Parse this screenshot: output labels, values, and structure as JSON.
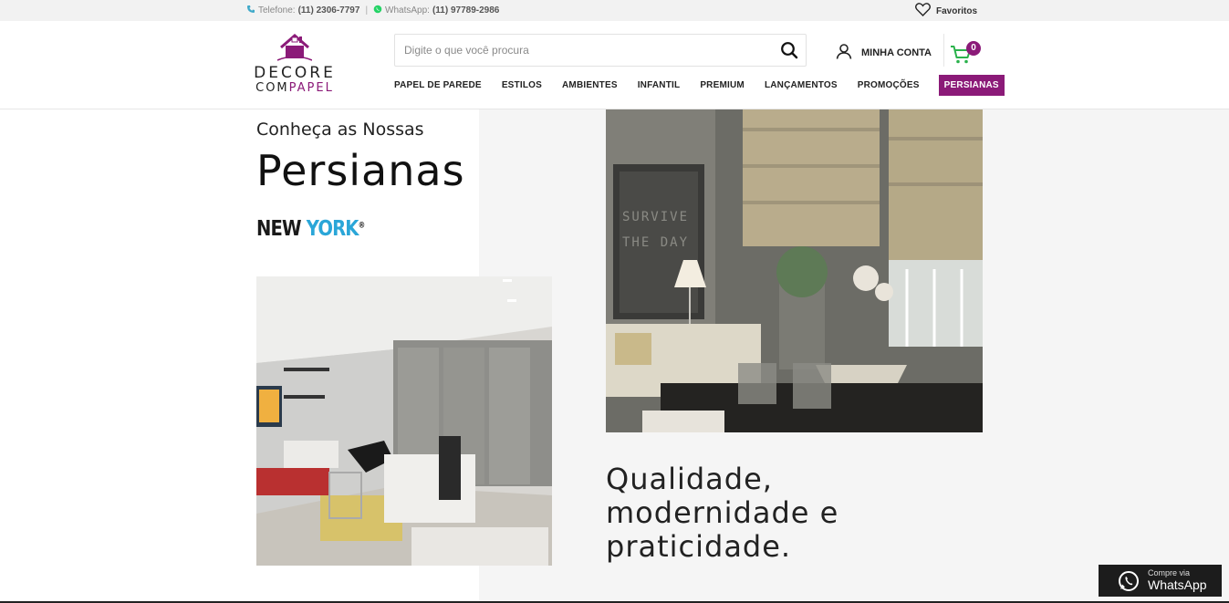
{
  "topbar": {
    "phone_label": "Telefone:",
    "phone_number": "(11) 2306-7797",
    "separator": "|",
    "whatsapp_label": "WhatsApp:",
    "whatsapp_number": "(11) 97789-2986",
    "favorites": "Favoritos"
  },
  "logo": {
    "line1": "DECORE",
    "line2_part1": "COM",
    "line2_part2": "PAPEL"
  },
  "search": {
    "placeholder": "Digite o que você procura"
  },
  "account": {
    "label": "MINHA CONTA"
  },
  "cart": {
    "count": "0"
  },
  "nav": {
    "items": [
      {
        "label": "PAPEL DE PAREDE"
      },
      {
        "label": "ESTILOS"
      },
      {
        "label": "AMBIENTES"
      },
      {
        "label": "INFANTIL"
      },
      {
        "label": "PREMIUM"
      },
      {
        "label": "LANÇAMENTOS"
      },
      {
        "label": "PROMOÇÕES"
      },
      {
        "label": "PERSIANAS"
      }
    ]
  },
  "main": {
    "intro": "Conheça as Nossas",
    "title": "Persianas",
    "brand_part1": "NEW",
    "brand_part2": "YORK",
    "brand_mark": "®",
    "tagline": "Qualidade, modernidade e praticidade.",
    "photo_right_text1": "SURVIVE",
    "photo_right_text2": "THE DAY"
  },
  "whatsapp_float": {
    "small": "Compre via",
    "big": "WhatsApp"
  },
  "colors": {
    "accent": "#8b1a78",
    "cart_green": "#2bb24c",
    "whatsapp_green": "#25d366",
    "brand_blue": "#2aa6d8"
  }
}
